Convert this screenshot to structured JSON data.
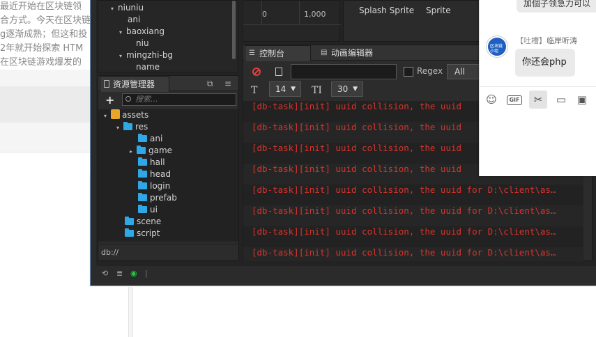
{
  "background_page": {
    "article_lines": [
      "最近开始在区块链领",
      "合方式。今天在区块链",
      "g逐渐成熟；但这和投",
      "2年就开始探索 HTM",
      "在区块链游戏爆发的"
    ]
  },
  "hierarchy": {
    "items": [
      {
        "label": "niuniu",
        "caret": "▾"
      },
      {
        "label": "ani",
        "caret": ""
      },
      {
        "label": "baoxiang",
        "caret": "▾"
      },
      {
        "label": "niu",
        "caret": ""
      },
      {
        "label": "mingzhi-bg",
        "caret": "▾"
      },
      {
        "label": "name",
        "caret": ""
      }
    ]
  },
  "preview": {
    "tick_0": "0",
    "tick_1000": "1,000"
  },
  "inspector": {
    "col1": "Splash Sprite",
    "col2": "Sprite"
  },
  "assets_panel": {
    "title": "资源管理器",
    "search_placeholder": "搜索...",
    "db_path": "db://",
    "tree": [
      {
        "label": "assets",
        "caret": "▾",
        "type": "root"
      },
      {
        "label": "res",
        "caret": "▾",
        "type": "folder"
      },
      {
        "label": "ani",
        "caret": "",
        "type": "folder"
      },
      {
        "label": "game",
        "caret": "▸",
        "type": "folder"
      },
      {
        "label": "hall",
        "caret": "",
        "type": "folder"
      },
      {
        "label": "head",
        "caret": "",
        "type": "folder"
      },
      {
        "label": "login",
        "caret": "",
        "type": "folder"
      },
      {
        "label": "prefab",
        "caret": "",
        "type": "folder"
      },
      {
        "label": "ui",
        "caret": "",
        "type": "folder"
      },
      {
        "label": "scene",
        "caret": "",
        "type": "folder"
      },
      {
        "label": "script",
        "caret": "",
        "type": "folder"
      }
    ]
  },
  "console": {
    "tab_console": "控制台",
    "tab_animation": "动画编辑器",
    "regex_label": "Regex",
    "level_value": "All",
    "font_size": "14",
    "line_height": "30",
    "filter_value": "",
    "logs": [
      "[db-task][init] uuid collision, the uuid",
      "[db-task][init] uuid collision, the uuid",
      "[db-task][init] uuid collision, the uuid",
      "[db-task][init] uuid collision, the uuid",
      "[db-task][init] uuid collision, the uuid for D:\\client\\as…",
      "[db-task][init] uuid collision, the uuid for D:\\client\\as…",
      "[db-task][init] uuid collision, the uuid for D:\\client\\as…",
      "[db-task][init] uuid collision, the uuid for D:\\client\\as…"
    ]
  },
  "chat": {
    "top_bubble": "加個子领急力可以",
    "sender_tag": "【吐槽】",
    "sender_name": "临岸听涛",
    "avatar_text": "区块链小组",
    "message": "你还会php",
    "tools": [
      "smile-icon",
      "gif-icon",
      "scissors-icon",
      "folder-icon",
      "image-icon"
    ]
  },
  "colors": {
    "log_error": "#d9342b",
    "folder": "#2fa8e8",
    "assets_root": "#e8a52a",
    "eye_status": "#27c93f"
  }
}
